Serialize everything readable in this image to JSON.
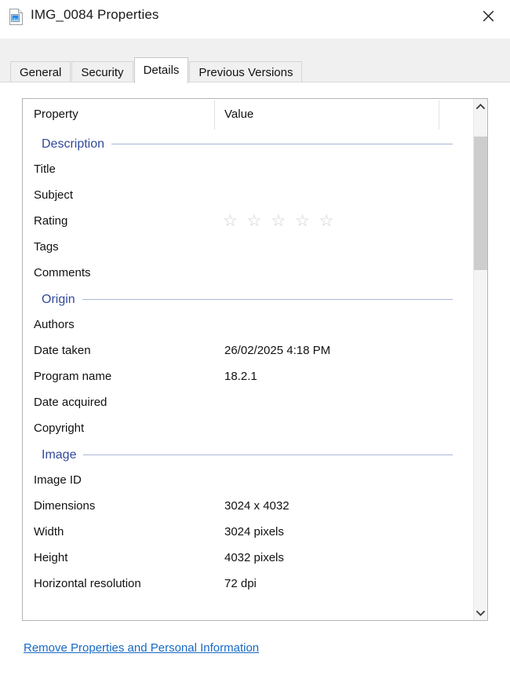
{
  "window": {
    "title": "IMG_0084 Properties",
    "icon": "image-file-icon",
    "close_label": "✕"
  },
  "tabs": [
    {
      "label": "General",
      "active": false
    },
    {
      "label": "Security",
      "active": false
    },
    {
      "label": "Details",
      "active": true
    },
    {
      "label": "Previous Versions",
      "active": false
    }
  ],
  "details": {
    "columns": {
      "property": "Property",
      "value": "Value"
    },
    "groups": [
      {
        "title": "Description",
        "rows": [
          {
            "name": "Title",
            "value": ""
          },
          {
            "name": "Subject",
            "value": ""
          },
          {
            "name": "Rating",
            "value": "",
            "widget": "stars",
            "stars": "☆ ☆ ☆ ☆ ☆",
            "stars_filled": 0,
            "stars_total": 5
          },
          {
            "name": "Tags",
            "value": ""
          },
          {
            "name": "Comments",
            "value": ""
          }
        ]
      },
      {
        "title": "Origin",
        "rows": [
          {
            "name": "Authors",
            "value": ""
          },
          {
            "name": "Date taken",
            "value": "26/02/2025 4:18 PM"
          },
          {
            "name": "Program name",
            "value": "18.2.1"
          },
          {
            "name": "Date acquired",
            "value": ""
          },
          {
            "name": "Copyright",
            "value": ""
          }
        ]
      },
      {
        "title": "Image",
        "rows": [
          {
            "name": "Image ID",
            "value": ""
          },
          {
            "name": "Dimensions",
            "value": "3024 x 4032"
          },
          {
            "name": "Width",
            "value": "3024 pixels"
          },
          {
            "name": "Height",
            "value": "4032 pixels"
          },
          {
            "name": "Horizontal resolution",
            "value": "72 dpi"
          }
        ]
      }
    ]
  },
  "scrollbar": {
    "up_arrow": "chevron-up",
    "down_arrow": "chevron-down",
    "thumb_top_pct": 4.8,
    "thumb_height_pct": 27
  },
  "footer": {
    "remove_properties_link": "Remove Properties and Personal Information"
  },
  "colors": {
    "group_header": "#31499b",
    "link": "#1769c4",
    "tab_strip": "#f0f0f0",
    "scrollbar_thumb": "#cdcdcd"
  }
}
